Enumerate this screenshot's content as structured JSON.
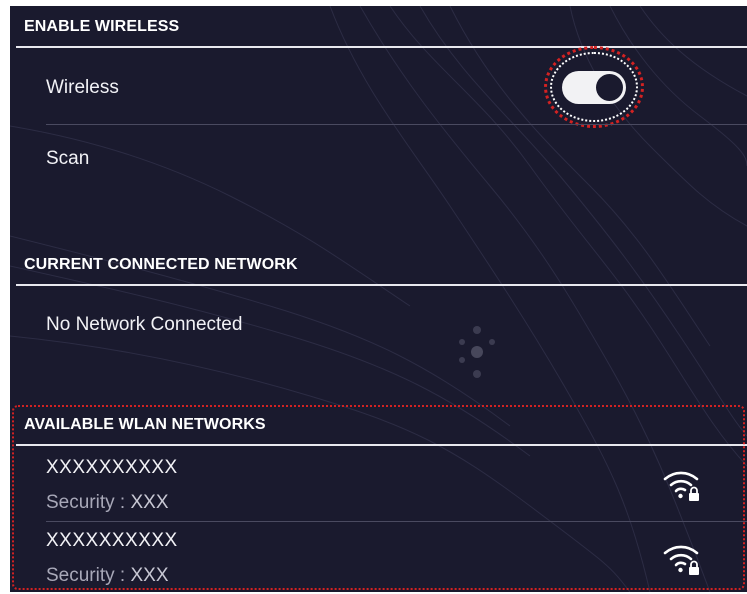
{
  "sections": {
    "enable_wireless": {
      "header": "ENABLE WIRELESS",
      "wireless_label": "Wireless",
      "wireless_enabled": true,
      "scan_label": "Scan"
    },
    "current_network": {
      "header": "CURRENT CONNECTED NETWORK",
      "status": "No Network Connected"
    },
    "available_networks": {
      "header": "AVAILABLE WLAN NETWORKS",
      "networks": [
        {
          "name": "XXXXXXXXXX",
          "security_label": "Security : ",
          "security_value": "XXX",
          "icon": "wifi-lock-icon"
        },
        {
          "name": "XXXXXXXXXX",
          "security_label": "Security : ",
          "security_value": "XXX",
          "icon": "wifi-lock-icon"
        }
      ]
    }
  },
  "colors": {
    "background": "#1a1a2e",
    "text": "#f2f2f6",
    "highlight": "#d32222"
  }
}
